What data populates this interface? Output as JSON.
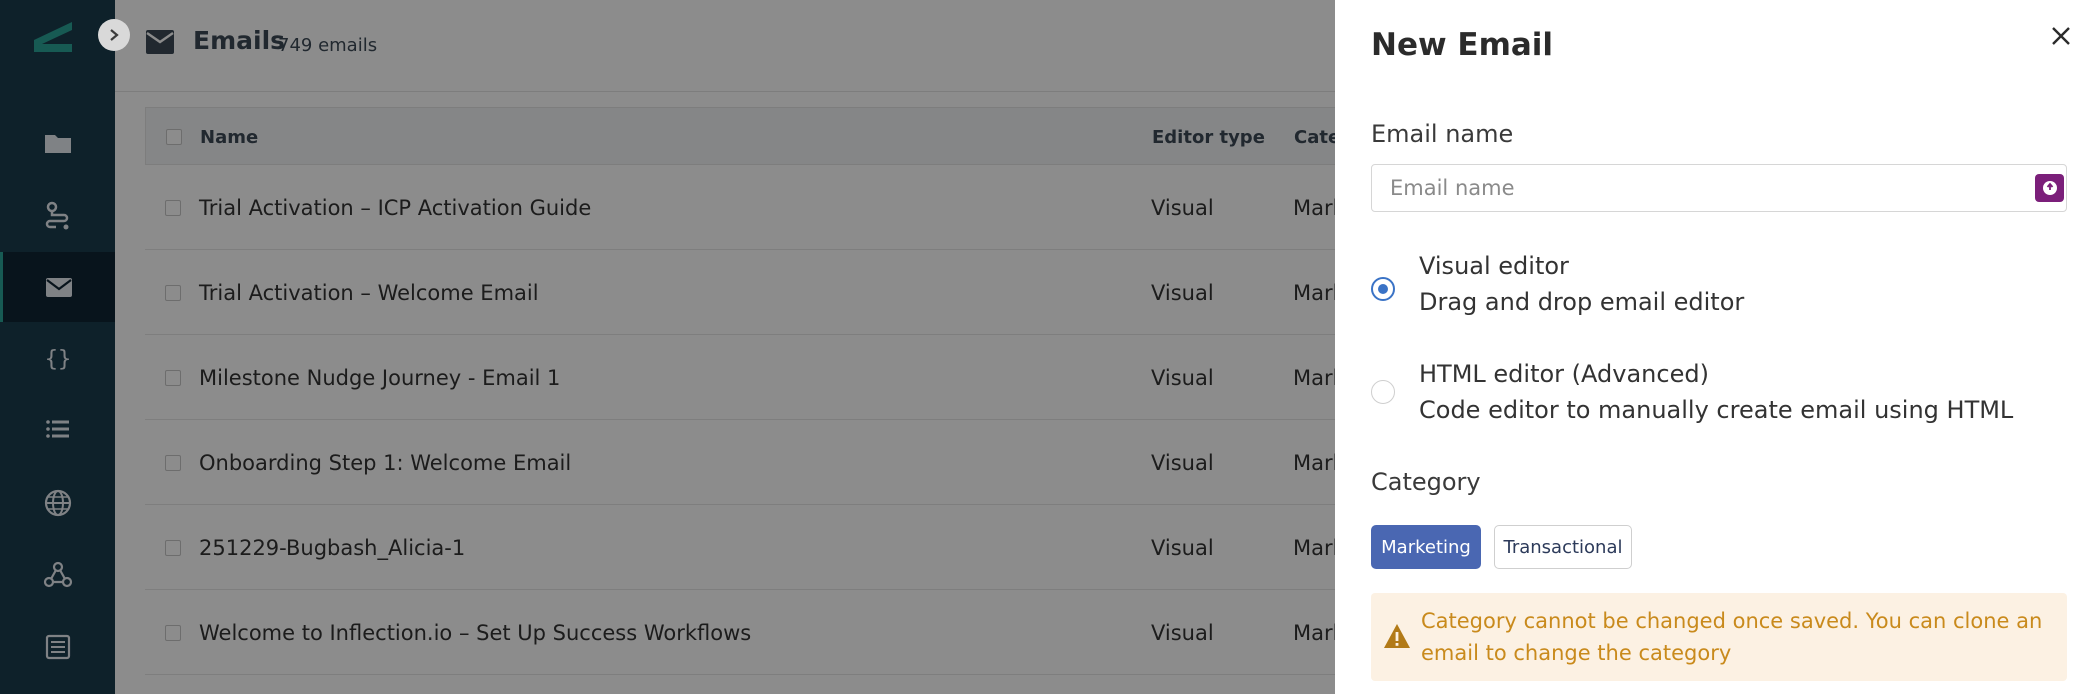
{
  "sidebar": {
    "items": [
      {
        "icon": "folder-icon"
      },
      {
        "icon": "journey-icon"
      },
      {
        "icon": "mail-icon",
        "active": true
      },
      {
        "icon": "code-braces-icon"
      },
      {
        "icon": "list-icon"
      },
      {
        "icon": "globe-icon"
      },
      {
        "icon": "webhook-icon"
      },
      {
        "icon": "table-icon"
      }
    ]
  },
  "header": {
    "title": "Emails",
    "count": "749 emails"
  },
  "table": {
    "columns": [
      "Name",
      "Editor type",
      "Cate"
    ],
    "rows": [
      {
        "name": "Trial Activation – ICP Activation Guide",
        "editor": "Visual",
        "category": "Mark"
      },
      {
        "name": "Trial Activation – Welcome Email",
        "editor": "Visual",
        "category": "Mark"
      },
      {
        "name": "Milestone Nudge Journey - Email 1",
        "editor": "Visual",
        "category": "Mark"
      },
      {
        "name": "Onboarding Step 1: Welcome Email",
        "editor": "Visual",
        "category": "Mark"
      },
      {
        "name": "251229-Bugbash_Alicia-1",
        "editor": "Visual",
        "category": "Mark"
      },
      {
        "name": "Welcome to Inflection.io – Set Up Success Workflows",
        "editor": "Visual",
        "category": "Mark"
      }
    ]
  },
  "panel": {
    "title": "New Email",
    "email_name_label": "Email name",
    "email_name_placeholder": "Email name",
    "email_name_value": "",
    "options": [
      {
        "title": "Visual editor",
        "desc": "Drag and drop email editor",
        "selected": true
      },
      {
        "title": "HTML editor (Advanced)",
        "desc": "Code editor to manually create email using HTML",
        "selected": false
      }
    ],
    "category_label": "Category",
    "categories": [
      {
        "label": "Marketing",
        "selected": true
      },
      {
        "label": "Transactional",
        "selected": false
      }
    ],
    "alert": "Category cannot be changed once saved. You can clone an email to change the category"
  },
  "colors": {
    "sidebar_bg": "#1b3c4e",
    "accent": "#2aa598",
    "primary": "#4a67b2",
    "radio": "#3a73c6",
    "badge": "#7b1f7a",
    "warning_text": "#c98a1c",
    "warning_bg": "#fcf1e3"
  }
}
